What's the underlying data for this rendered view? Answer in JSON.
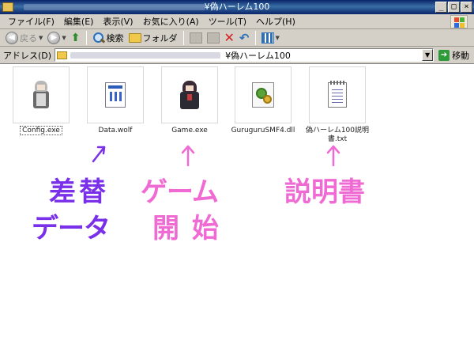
{
  "window": {
    "title": "¥偽ハーレム100",
    "buttons": {
      "minimize": "_",
      "maximize": "□",
      "close": "×"
    }
  },
  "menubar": {
    "items": [
      "ファイル(F)",
      "編集(E)",
      "表示(V)",
      "お気に入り(A)",
      "ツール(T)",
      "ヘルプ(H)"
    ]
  },
  "toolbar": {
    "back_label": "戻る",
    "search_label": "検索",
    "folders_label": "フォルダ"
  },
  "addressbar": {
    "label": "アドレス(D)",
    "path_visible": "¥偽ハーレム100",
    "go_label": "移動"
  },
  "files": [
    {
      "name": "Config.exe",
      "icon": "sprite-grey-character-icon"
    },
    {
      "name": "Data.wolf",
      "icon": "document-icon"
    },
    {
      "name": "Game.exe",
      "icon": "sprite-dark-character-icon"
    },
    {
      "name": "GuruguruSMF4.dll",
      "icon": "dll-icon"
    },
    {
      "name": "偽ハーレム100説明書.txt",
      "icon": "text-file-icon"
    }
  ],
  "annotations": {
    "data_line1": "差替",
    "data_line2": "データ",
    "game_line1": "ゲーム",
    "game_line2": "開 始",
    "readme": "説明書",
    "colors": {
      "purple": "#7a30e8",
      "pink": "#f06ad4"
    }
  }
}
